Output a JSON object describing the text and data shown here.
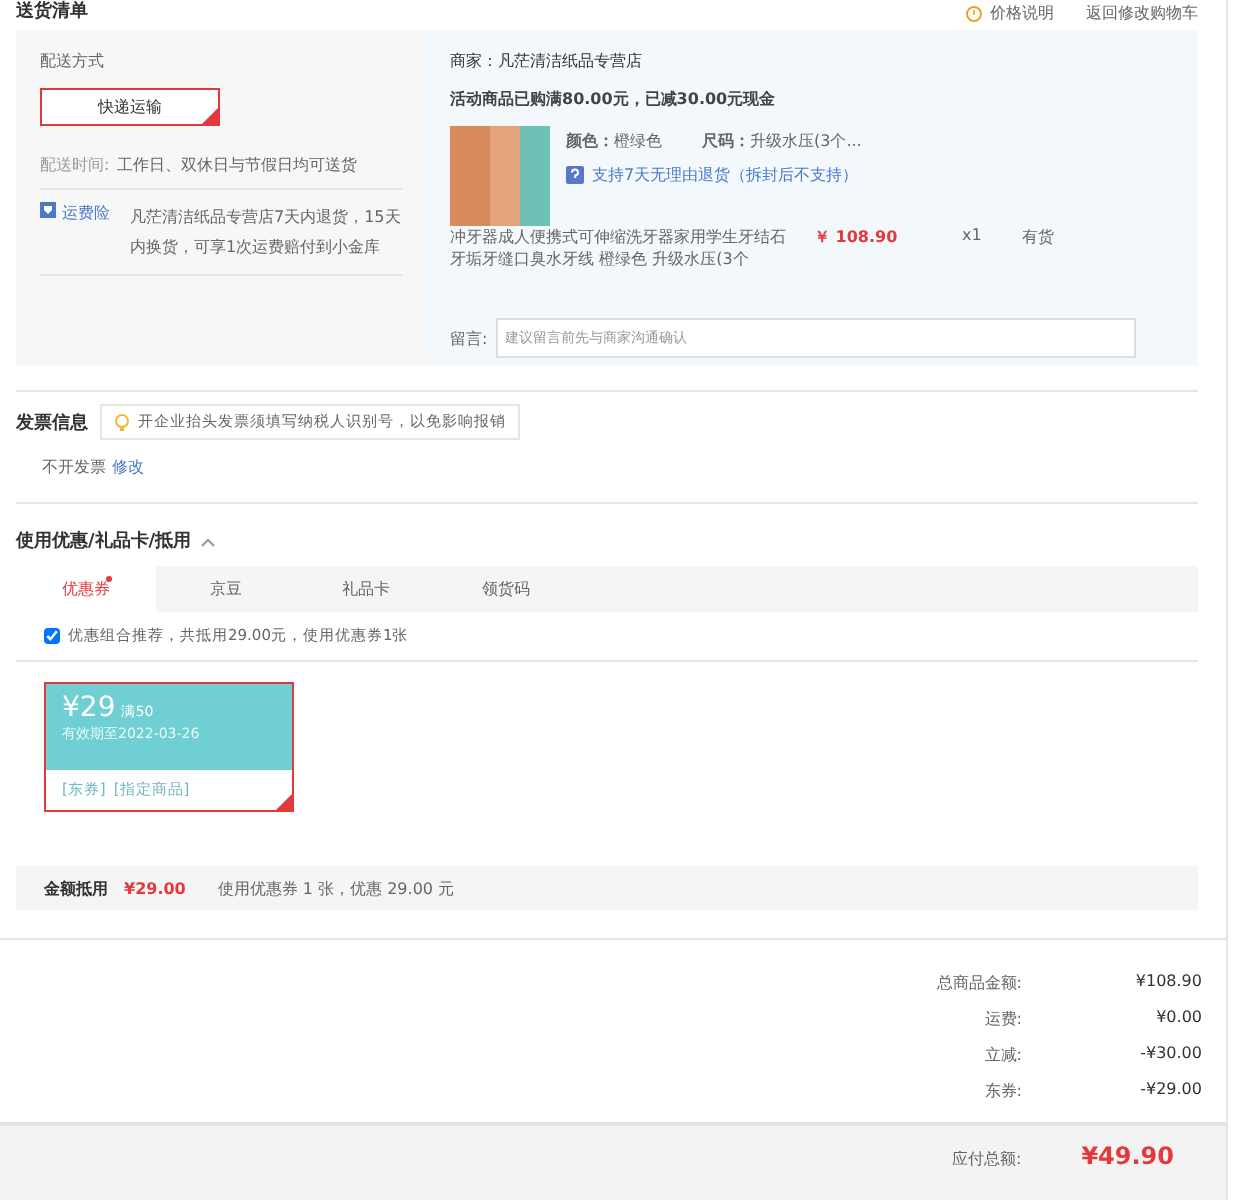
{
  "header": {
    "title": "送货清单",
    "price_note": "价格说明",
    "back_link": "返回修改购物车"
  },
  "shipping": {
    "label": "配送方式",
    "method": "快递运输",
    "method_selected": true,
    "time_label": "配送时间:",
    "time_value": "工作日、双休日与节假日均可送货",
    "insurance_badge": "运费险",
    "insurance_text": "凡茫清洁纸品专营店7天内退货，15天内换货，可享1次运费赔付到小金库"
  },
  "order": {
    "shop": "商家：凡茫清洁纸品专营店",
    "promo": "活动商品已购满80.00元，已减30.00元现金",
    "color_label": "颜色：",
    "color_value": "橙绿色",
    "size_label": "尺码：",
    "size_value": "升级水压(3个...",
    "return_policy": "支持7天无理由退货（拆封后不支持）",
    "name": "冲牙器成人便携式可伸缩洗牙器家用学生牙结石牙垢牙缝口臭水牙线 橙绿色 升级水压(3个",
    "price": "￥ 108.90",
    "qty": "x1",
    "stock": "有货",
    "note_label": "留言:",
    "note_placeholder": "建议留言前先与商家沟通确认"
  },
  "invoice": {
    "title": "发票信息",
    "tip": "开企业抬头发票须填写纳税人识别号，以免影响报销",
    "value": "不开发票",
    "edit": "修改"
  },
  "discounts": {
    "title": "使用优惠/礼品卡/抵用",
    "expanded": true,
    "tabs": [
      {
        "label": "优惠券",
        "selected": true,
        "dot": true
      },
      {
        "label": "京豆",
        "selected": false,
        "dot": false
      },
      {
        "label": "礼品卡",
        "selected": false,
        "dot": false
      },
      {
        "label": "领货码",
        "selected": false,
        "dot": false
      }
    ],
    "combo_checked": true,
    "combo_text": "优惠组合推荐，共抵用29.00元，使用优惠券1张",
    "coupons": [
      {
        "amount": "¥29",
        "condition": "满50",
        "validity": "有效期至2022-03-26",
        "tags": [
          "[东券]",
          "[指定商品]"
        ],
        "selected": true
      }
    ],
    "summary_label": "金额抵用",
    "summary_amount": "¥29.00",
    "summary_text": "使用优惠券 1 张，优惠 29.00 元"
  },
  "totals": [
    {
      "label": "总商品金额:",
      "value": "¥108.90"
    },
    {
      "label": "运费:",
      "value": "¥0.00"
    },
    {
      "label": "立减:",
      "value": "-¥30.00"
    },
    {
      "label": "东券:",
      "value": "-¥29.00"
    }
  ],
  "payable": {
    "label": "应付总额:",
    "value": "¥49.90"
  }
}
